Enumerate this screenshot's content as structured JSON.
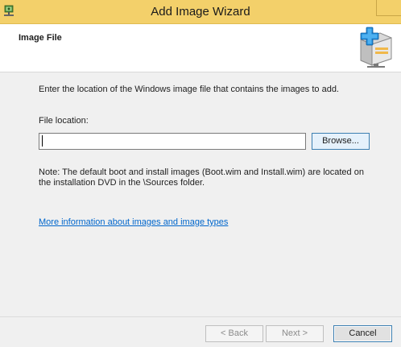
{
  "window": {
    "title": "Add Image Wizard",
    "accent_color": "#f3d06a",
    "icon": "wds-server-icon"
  },
  "header": {
    "page_title": "Image File",
    "icon": "add-image-wizard-icon"
  },
  "content": {
    "instruction": "Enter the location of the Windows image file that contains the images to add.",
    "file_location_label": "File location:",
    "file_location_value": "",
    "browse_label": "Browse...",
    "note": "Note: The default boot and install images (Boot.wim and Install.wim) are located on the installation DVD in the \\Sources folder.",
    "more_info_link": "More information about images and image types",
    "link_color": "#0066cc"
  },
  "footer": {
    "back_label": "< Back",
    "next_label": "Next >",
    "cancel_label": "Cancel"
  }
}
